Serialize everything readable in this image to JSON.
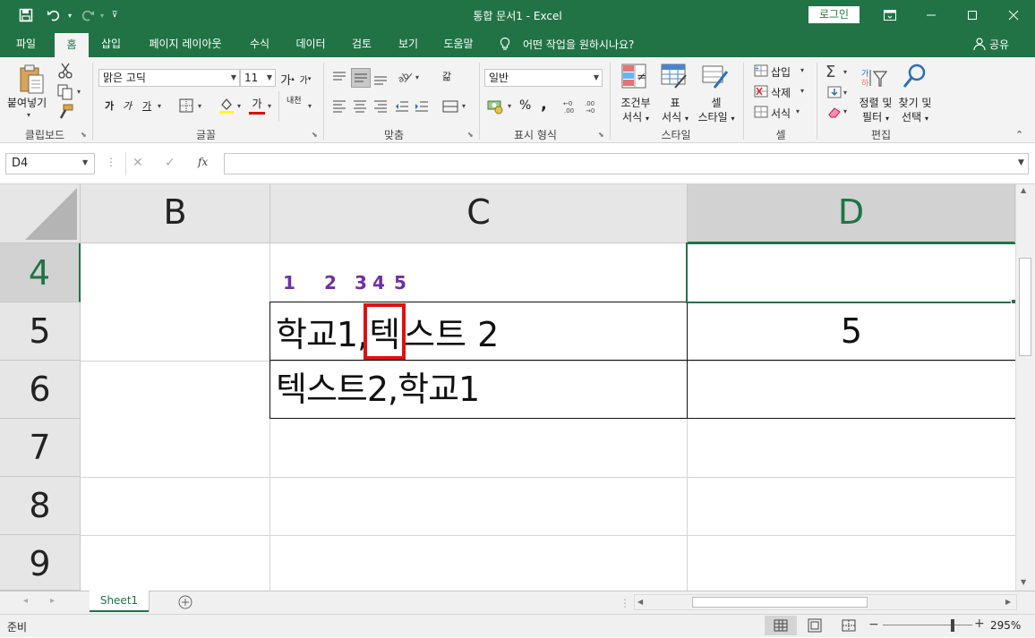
{
  "titlebar": {
    "title": "통합 문서1  -  Excel",
    "login": "로그인",
    "icons": [
      "save-icon",
      "undo-icon",
      "redo-icon",
      "customize-icon",
      "ribbon-display-icon",
      "minimize-icon",
      "maximize-icon",
      "close-icon"
    ]
  },
  "tabs": [
    "파일",
    "홈",
    "삽입",
    "페이지 레이아웃",
    "수식",
    "데이터",
    "검토",
    "보기",
    "도움말"
  ],
  "tell_me": "어떤 작업을 원하시나요?",
  "share": "공유",
  "ribbon": {
    "clipboard": {
      "label": "클립보드",
      "paste": "붙여넣기"
    },
    "font": {
      "label": "글꼴",
      "name": "맑은 고딕",
      "size": "11",
      "grow": "가",
      "shrink": "가",
      "bold": "가",
      "italic": "가",
      "underline": "가",
      "color_a": "가",
      "phonetic": "내천"
    },
    "alignment": {
      "label": "맞춤",
      "wrap": "갊"
    },
    "number": {
      "label": "표시 형식",
      "format": "일반",
      "percent": "%",
      "comma": ","
    },
    "styles": {
      "label": "스타일",
      "conditional": "조건부\n서식",
      "conditional_1": "조건부",
      "conditional_2": "서식",
      "table_1": "표",
      "table_2": "서식",
      "cell_1": "셀",
      "cell_2": "스타일"
    },
    "cells": {
      "label": "셀",
      "insert": "삽입",
      "delete": "삭제",
      "format": "서식"
    },
    "editing": {
      "label": "편집",
      "sort_1": "정렬 및",
      "sort_2": "필터",
      "find_1": "찾기 및",
      "find_2": "선택"
    }
  },
  "formula_bar": {
    "namebox": "D4",
    "fx": "fx",
    "value": ""
  },
  "grid": {
    "columns": [
      "B",
      "C",
      "D"
    ],
    "rows": [
      "4",
      "5",
      "6",
      "7",
      "8",
      "9"
    ],
    "selected_col": "D",
    "selected_row": "4",
    "cells": {
      "C4_markers": [
        "1",
        "2",
        "3",
        "4",
        "5"
      ],
      "C5": "학교1,텍스트 2",
      "C5_parts": [
        "학교1,",
        "텍",
        "스트 2"
      ],
      "D5": "5",
      "C6": "텍스트2,학교1"
    },
    "highlight_color": "#e01010",
    "marker_color": "#7030a0"
  },
  "sheet_tabs": {
    "active": "Sheet1"
  },
  "status": {
    "ready": "준비",
    "zoom": "295%"
  },
  "colors": {
    "accent": "#217346"
  }
}
